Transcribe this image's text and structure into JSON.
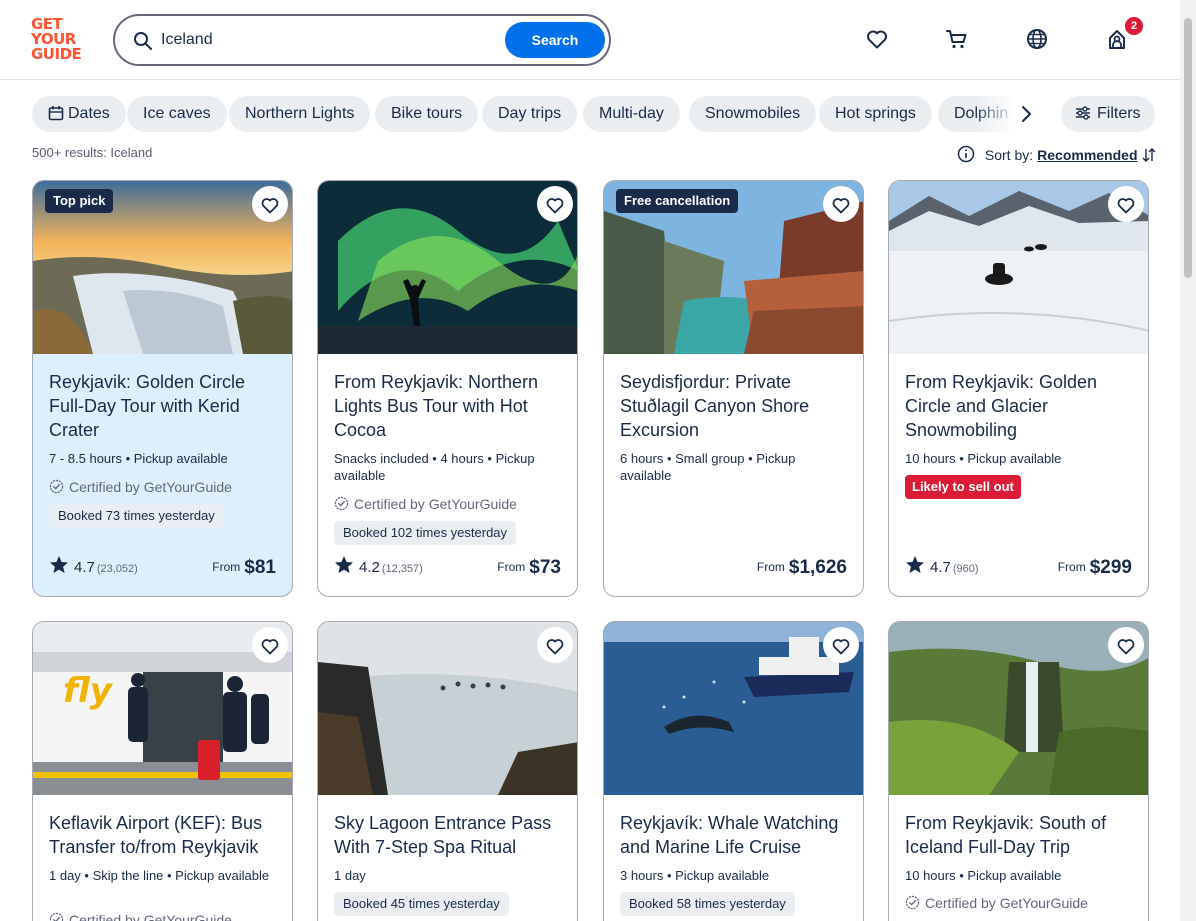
{
  "header": {
    "logo": [
      "GET",
      "YOUR",
      "GUIDE"
    ],
    "search_value": "Iceland",
    "search_button": "Search",
    "cart_badge": "2",
    "icons": [
      "search-icon",
      "heart-icon",
      "cart-icon",
      "globe-icon",
      "user-icon"
    ]
  },
  "chips": [
    "Dates",
    "Ice caves",
    "Northern Lights",
    "Bike tours",
    "Day trips",
    "Multi-day",
    "Snowmobiles",
    "Hot springs",
    "Dolphin"
  ],
  "filters_label": "Filters",
  "results_text": "500+ results: Iceland",
  "sort": {
    "label": "Sort by:",
    "value": "Recommended"
  },
  "cards": [
    {
      "tag": "Top pick",
      "title": "Reykjavik: Golden Circle Full-Day Tour with Kerid Crater",
      "meta": "7 - 8.5 hours • Pickup available",
      "certified": "Certified by GetYourGuide",
      "booked": "Booked 73 times yesterday",
      "rating": "4.7",
      "reviews": "(23,052)",
      "price_prefix": "From",
      "price": "$81"
    },
    {
      "title": "From Reykjavik: Northern Lights Bus Tour with Hot Cocoa",
      "meta": "Snacks included • 4 hours • Pickup available",
      "certified": "Certified by GetYourGuide",
      "booked": "Booked 102 times yesterday",
      "rating": "4.2",
      "reviews": "(12,357)",
      "price_prefix": "From",
      "price": "$73"
    },
    {
      "tag": "Free cancellation",
      "title": "Seydisfjordur: Private Stuðlagil Canyon Shore Excursion",
      "meta": "6 hours • Small group • Pickup available",
      "price_prefix": "From",
      "price": "$1,626"
    },
    {
      "title": "From Reykjavik: Golden Circle and Glacier Snowmobiling",
      "meta": "10 hours • Pickup available",
      "sellout": "Likely to sell out",
      "rating": "4.7",
      "reviews": "(960)",
      "price_prefix": "From",
      "price": "$299"
    },
    {
      "title": "Keflavik Airport (KEF): Bus Transfer to/from Reykjavik",
      "meta": "1 day • Skip the line • Pickup available",
      "certified": "Certified by GetYourGuide"
    },
    {
      "title": "Sky Lagoon Entrance Pass With 7-Step Spa Ritual",
      "meta": "1 day",
      "booked": "Booked 45 times yesterday"
    },
    {
      "title": "Reykjavík: Whale Watching and Marine Life Cruise",
      "meta": "3 hours • Pickup available",
      "booked": "Booked 58 times yesterday"
    },
    {
      "title": "From Reykjavik: South of Iceland Full-Day Trip",
      "meta": "10 hours • Pickup available",
      "certified": "Certified by GetYourGuide"
    }
  ],
  "colors": {
    "brand": "#ff5533",
    "accent": "#0071eb",
    "text": "#1a2b49",
    "alert": "#dc1b36",
    "highlight": "#ddeefd"
  }
}
